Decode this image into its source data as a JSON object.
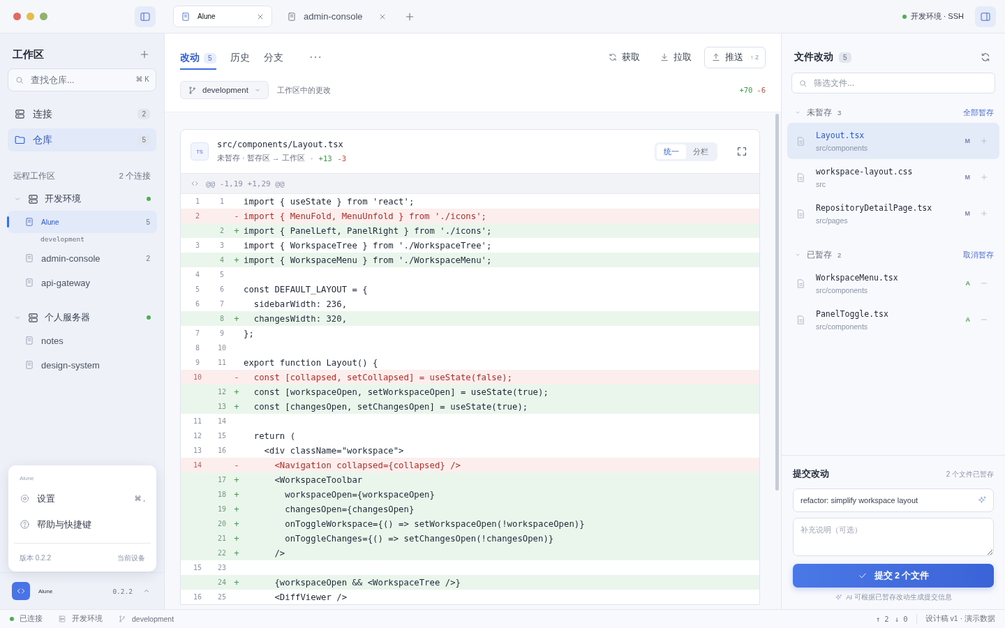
{
  "titlebar": {
    "tabs": [
      {
        "label": "Alune",
        "selected": true
      },
      {
        "label": "admin-console",
        "selected": false
      }
    ],
    "environment": {
      "label": "开发环境 · SSH",
      "color": "#4caf50"
    }
  },
  "sidebar": {
    "title": "工作区",
    "search": {
      "placeholder": "查找仓库...",
      "shortcut": "⌘ K"
    },
    "nav": [
      {
        "label": "连接",
        "count": "2",
        "selected": false
      },
      {
        "label": "仓库",
        "count": "5",
        "selected": true
      }
    ],
    "section": {
      "title": "远程工作区",
      "meta": "2 个连接"
    },
    "hosts": [
      {
        "name": "开发环境",
        "expanded": true,
        "color": "#4caf50",
        "children": [
          {
            "name": "Alune",
            "count": "5",
            "branch": "development",
            "selected": true
          },
          {
            "name": "admin-console",
            "count": "2",
            "selected": false
          },
          {
            "name": "api-gateway",
            "selected": false
          }
        ]
      },
      {
        "name": "个人服务器",
        "expanded": true,
        "color": "#4caf50",
        "children": [
          {
            "name": "notes",
            "selected": false
          },
          {
            "name": "design-system",
            "selected": false
          }
        ]
      }
    ],
    "menu": {
      "app": "Alune",
      "items": [
        {
          "label": "设置",
          "shortcut": "⌘ ,"
        },
        {
          "label": "帮助与快捷键"
        }
      ],
      "version": "版本 0.2.2",
      "device": "当前设备"
    },
    "footer": {
      "app": "Alune",
      "version": "0.2.2"
    }
  },
  "main": {
    "tabs": [
      {
        "label": "改动",
        "count": "5",
        "selected": true
      },
      {
        "label": "历史",
        "selected": false
      },
      {
        "label": "分支",
        "selected": false
      }
    ],
    "actions": [
      {
        "label": "获取",
        "outlined": false
      },
      {
        "label": "拉取",
        "outlined": false
      },
      {
        "label": "推送",
        "count": "↑ 2",
        "outlined": true
      }
    ],
    "branch": "development",
    "scope": "工作区中的更改",
    "additions": "+70",
    "deletions": "-6",
    "diff": {
      "badge": "TS",
      "path": "src/components/Layout.tsx",
      "meta": "未暂存 · 暂存区 → 工作区",
      "separator": "·",
      "additions": "+13",
      "deletions": "-3",
      "views": [
        {
          "label": "统一",
          "selected": true
        },
        {
          "label": "分栏",
          "selected": false
        }
      ],
      "hunk": "@@ -1,19 +1,29 @@",
      "lines": [
        {
          "kind": "context",
          "old": "1",
          "new": "1",
          "code": "import { useState } from 'react';"
        },
        {
          "kind": "del",
          "old": "2",
          "sign": "-",
          "code": "import { MenuFold, MenuUnfold } from './icons';"
        },
        {
          "kind": "add",
          "new": "2",
          "sign": "+",
          "code": "import { PanelLeft, PanelRight } from './icons';"
        },
        {
          "kind": "context",
          "old": "3",
          "new": "3",
          "code": "import { WorkspaceTree } from './WorkspaceTree';"
        },
        {
          "kind": "add",
          "new": "4",
          "sign": "+",
          "code": "import { WorkspaceMenu } from './WorkspaceMenu';"
        },
        {
          "kind": "context",
          "old": "4",
          "new": "5"
        },
        {
          "kind": "context",
          "old": "5",
          "new": "6",
          "code": "const DEFAULT_LAYOUT = {"
        },
        {
          "kind": "context",
          "old": "6",
          "new": "7",
          "code": "  sidebarWidth: 236,"
        },
        {
          "kind": "add",
          "new": "8",
          "sign": "+",
          "code": "  changesWidth: 320,"
        },
        {
          "kind": "context",
          "old": "7",
          "new": "9",
          "code": "};"
        },
        {
          "kind": "context",
          "old": "8",
          "new": "10"
        },
        {
          "kind": "context",
          "old": "9",
          "new": "11",
          "code": "export function Layout() {"
        },
        {
          "kind": "del",
          "old": "10",
          "sign": "-",
          "code": "  const [collapsed, setCollapsed] = useState(false);"
        },
        {
          "kind": "add",
          "new": "12",
          "sign": "+",
          "code": "  const [workspaceOpen, setWorkspaceOpen] = useState(true);"
        },
        {
          "kind": "add",
          "new": "13",
          "sign": "+",
          "code": "  const [changesOpen, setChangesOpen] = useState(true);"
        },
        {
          "kind": "context",
          "old": "11",
          "new": "14"
        },
        {
          "kind": "context",
          "old": "12",
          "new": "15",
          "code": "  return ("
        },
        {
          "kind": "context",
          "old": "13",
          "new": "16",
          "code": "    <div className=\"workspace\">"
        },
        {
          "kind": "del",
          "old": "14",
          "sign": "-",
          "code": "      <Navigation collapsed={collapsed} />"
        },
        {
          "kind": "add",
          "new": "17",
          "sign": "+",
          "code": "      <WorkspaceToolbar"
        },
        {
          "kind": "add",
          "new": "18",
          "sign": "+",
          "code": "        workspaceOpen={workspaceOpen}"
        },
        {
          "kind": "add",
          "new": "19",
          "sign": "+",
          "code": "        changesOpen={changesOpen}"
        },
        {
          "kind": "add",
          "new": "20",
          "sign": "+",
          "code": "        onToggleWorkspace={() => setWorkspaceOpen(!workspaceOpen)}"
        },
        {
          "kind": "add",
          "new": "21",
          "sign": "+",
          "code": "        onToggleChanges={() => setChangesOpen(!changesOpen)}"
        },
        {
          "kind": "add",
          "new": "22",
          "sign": "+",
          "code": "      />"
        },
        {
          "kind": "context",
          "old": "15",
          "new": "23"
        },
        {
          "kind": "add",
          "new": "24",
          "sign": "+",
          "code": "      {workspaceOpen && <WorkspaceTree />}"
        },
        {
          "kind": "context",
          "old": "16",
          "new": "25",
          "code": "      <DiffViewer />"
        }
      ]
    }
  },
  "changes": {
    "title": "文件改动",
    "count": "5",
    "filter": {
      "placeholder": "筛选文件..."
    },
    "groups": [
      {
        "kind": "unstaged",
        "label": "未暂存",
        "count": "3",
        "action": "全部暂存",
        "expanded": true,
        "files": [
          {
            "name": "Layout.tsx",
            "dir": "src/components",
            "status": "M",
            "color": "#7a86a8",
            "selected": true
          },
          {
            "name": "workspace-layout.css",
            "dir": "src",
            "status": "M",
            "color": "#7a86a8",
            "selected": false
          },
          {
            "name": "RepositoryDetailPage.tsx",
            "dir": "src/pages",
            "status": "M",
            "color": "#7a86a8",
            "selected": false
          }
        ]
      },
      {
        "kind": "staged",
        "label": "已暂存",
        "count": "2",
        "action": "取消暂存",
        "expanded": true,
        "files": [
          {
            "name": "WorkspaceMenu.tsx",
            "dir": "src/components",
            "status": "A",
            "color": "#4caf50",
            "selected": false
          },
          {
            "name": "PanelToggle.tsx",
            "dir": "src/components",
            "status": "A",
            "color": "#4caf50",
            "selected": false
          }
        ]
      }
    ],
    "commit": {
      "title": "提交改动",
      "meta": "2 个文件已暂存",
      "message": "refactor: simplify workspace layout",
      "description": {
        "placeholder": "补充说明（可选）"
      },
      "button": "提交 2 个文件",
      "hint": "AI 可根据已暂存改动生成提交信息"
    }
  },
  "status_bar": {
    "connection": {
      "label": "已连接",
      "color": "#4caf50"
    },
    "host": "开发环境",
    "branch": "development",
    "ahead": "↑ 2",
    "behind": "↓ 0",
    "note": "设计稿 v1 · 演示数据"
  }
}
